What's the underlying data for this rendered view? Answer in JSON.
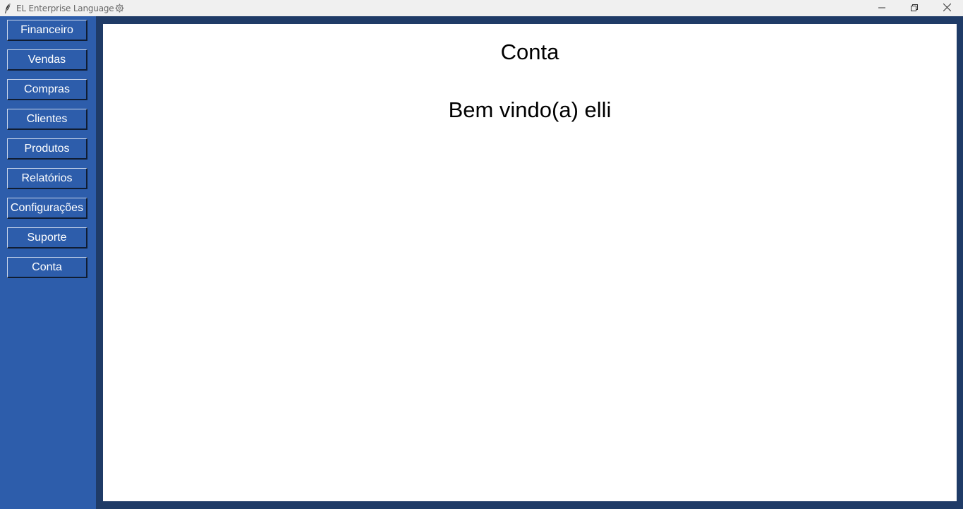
{
  "window": {
    "title": "EL Enterprise Language",
    "icons": {
      "app": "feather-icon",
      "settings": "gear-icon",
      "minimize": "minimize-icon",
      "restore": "restore-icon",
      "close": "close-icon"
    }
  },
  "sidebar": {
    "items": [
      {
        "label": "Financeiro"
      },
      {
        "label": "Vendas"
      },
      {
        "label": "Compras"
      },
      {
        "label": "Clientes"
      },
      {
        "label": "Produtos"
      },
      {
        "label": "Relatórios"
      },
      {
        "label": "Configurações"
      },
      {
        "label": "Suporte"
      },
      {
        "label": "Conta"
      }
    ]
  },
  "main": {
    "title": "Conta",
    "welcome": "Bem vindo(a) elli"
  },
  "colors": {
    "sidebar_bg": "#2d5dab",
    "frame_bg": "#1f3b67",
    "content_bg": "#ffffff",
    "button_text": "#ffffff"
  }
}
